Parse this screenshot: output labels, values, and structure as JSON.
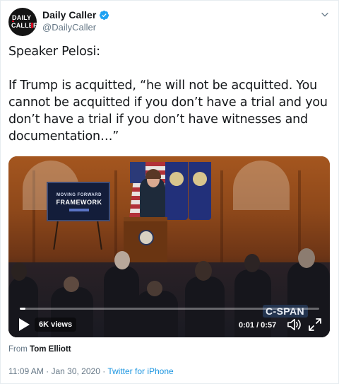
{
  "author": {
    "display_name": "Daily Caller",
    "handle": "@DailyCaller",
    "avatar_text_top": "DAILY",
    "avatar_text_bottom": "CALLER"
  },
  "tweet": {
    "line1": "Speaker Pelosi:",
    "line2": "If Trump is acquitted, “he will not be acquitted. You cannot be acquitted if you don’t have a trial and you don’t have a trial if you don’t have witnesses and documentation…”"
  },
  "video": {
    "banner_line1": "MOVING FORWARD",
    "banner_line2": "FRAMEWORK",
    "watermark": "C-SPAN",
    "views": "6K views",
    "time": "0:01 / 0:57",
    "progress": 0.02
  },
  "attribution": {
    "prefix": "From",
    "name": "Tom Elliott"
  },
  "meta": {
    "timestamp": "11:09 AM · Jan 30, 2020 · ",
    "source": "Twitter for iPhone"
  },
  "colors": {
    "link": "#1b95e0",
    "verified": "#1da1f2",
    "secondary_text": "#657786"
  },
  "icons": [
    "verified-badge-icon",
    "chevron-down-icon",
    "play-icon",
    "volume-icon",
    "fullscreen-icon"
  ]
}
